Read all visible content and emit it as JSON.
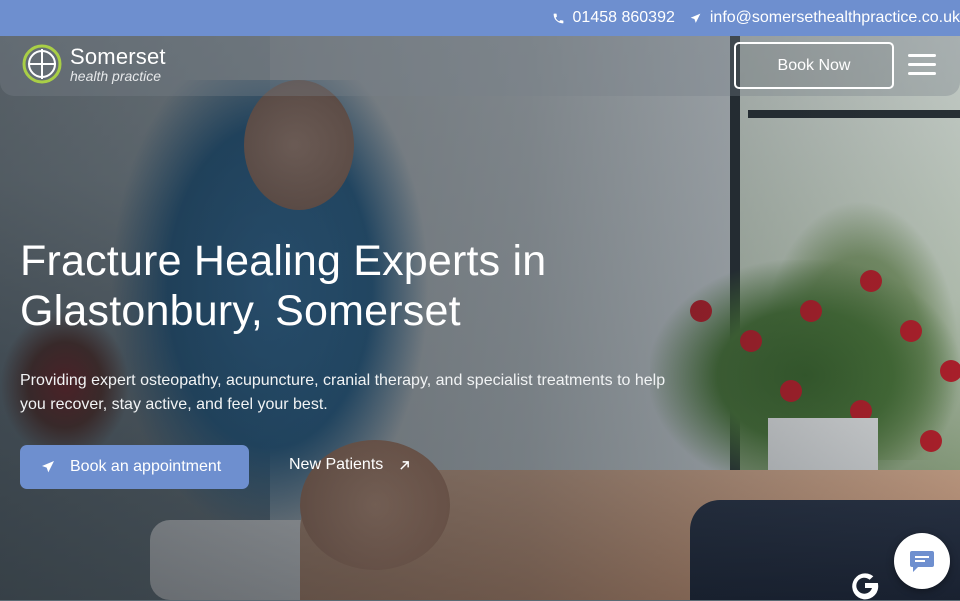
{
  "topbar": {
    "phone": "01458 860392",
    "email": "info@somersethealthpractice.co.uk",
    "phone_icon": "phone-icon",
    "email_icon": "send-arrow-icon",
    "background": "#6e8fcf"
  },
  "header": {
    "logo_primary": "Somerset",
    "logo_secondary": "health practice",
    "book_now_label": "Book Now",
    "menu_icon": "hamburger-menu-icon"
  },
  "hero": {
    "headline": "Fracture Healing Experts in Glastonbury, Somerset",
    "subtext": "Providing expert osteopathy, acupuncture, cranial therapy, and specialist treatments to help you recover, stay active, and feel your best.",
    "primary_cta": "Book an appointment",
    "secondary_cta": "New Patients",
    "accent": "#6e8fcf"
  },
  "widgets": {
    "google_icon": "google-g-icon",
    "chat_icon": "chat-bubble-icon"
  }
}
